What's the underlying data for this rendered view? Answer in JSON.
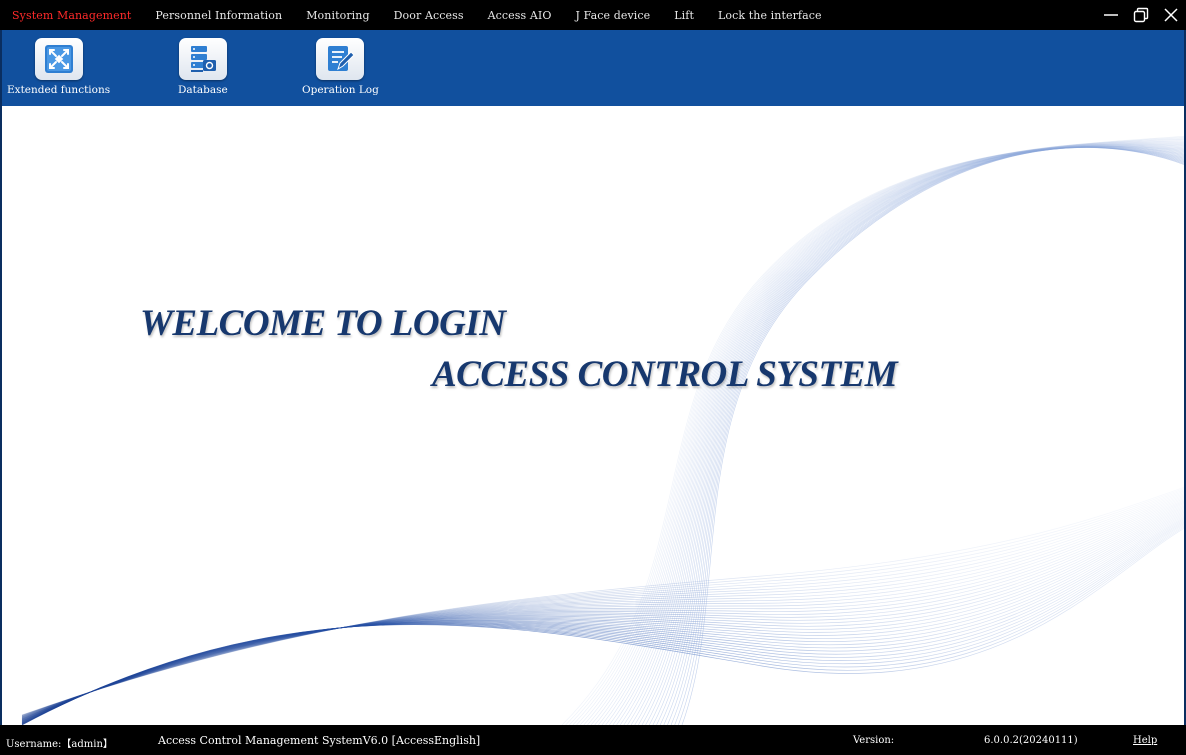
{
  "menu": {
    "items": [
      {
        "label": "System Management",
        "active": true
      },
      {
        "label": "Personnel Information"
      },
      {
        "label": "Monitoring"
      },
      {
        "label": "Door Access"
      },
      {
        "label": "Access AIO"
      },
      {
        "label": "J Face device"
      },
      {
        "label": "Lift"
      },
      {
        "label": "Lock the interface"
      }
    ]
  },
  "toolbar": {
    "extended_label": "Extended functions",
    "database_label": "Database",
    "oplog_label": "Operation Log"
  },
  "welcome": {
    "line1": "WELCOME TO LOGIN",
    "line2": "ACCESS CONTROL SYSTEM"
  },
  "status": {
    "username": "Username:【admin】",
    "system": "Access Control Management SystemV6.0 [AccessEnglish]",
    "version_label": "Version:",
    "version_value": "6.0.0.2(20240111)",
    "help": "Help"
  },
  "colors": {
    "toolbar_bg": "#11509e",
    "active_menu": "#ff2a2a",
    "welcome_text": "#17386e"
  }
}
